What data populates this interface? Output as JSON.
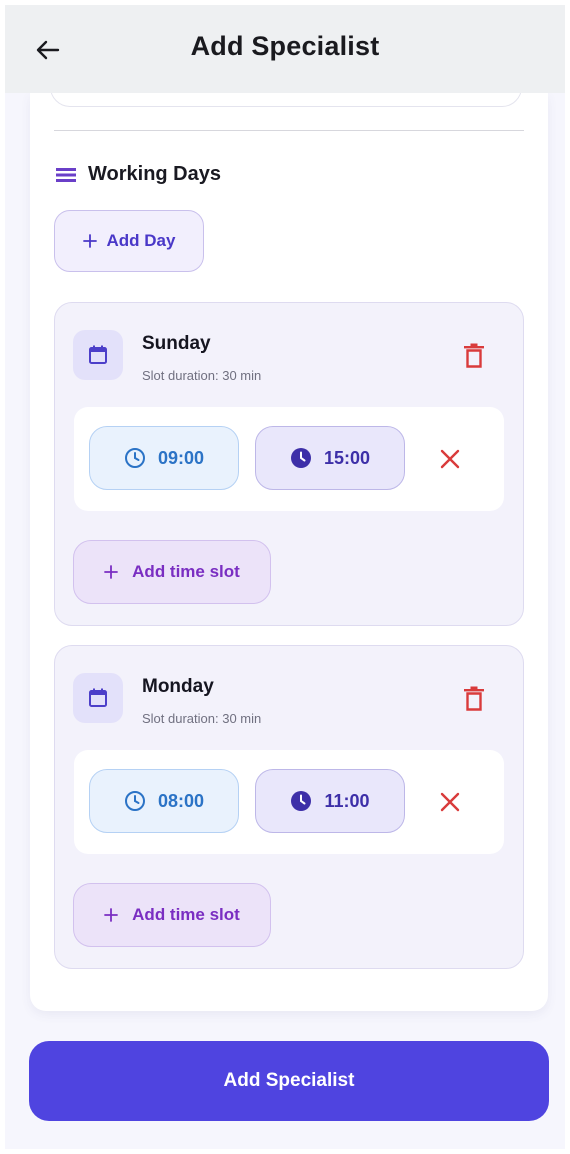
{
  "app_bar": {
    "title": "Add Specialist",
    "back_icon": "arrow-left-icon"
  },
  "working_days": {
    "section_title": "Working Days",
    "section_icon": "list-icon",
    "add_day_label": "Add Day",
    "days": [
      {
        "name": "Sunday",
        "slot_duration": "Slot duration: 30 min",
        "slots": [
          {
            "start": "09:00",
            "end": "15:00"
          }
        ],
        "add_slot_label": "Add time slot"
      },
      {
        "name": "Monday",
        "slot_duration": "Slot duration: 30 min",
        "slots": [
          {
            "start": "08:00",
            "end": "11:00"
          }
        ],
        "add_slot_label": "Add time slot"
      }
    ]
  },
  "submit": {
    "label": "Add Specialist"
  },
  "colors": {
    "primary": "#4f44e0",
    "accent_purple": "#7a2ec2",
    "start_time_blue": "#2b73c6",
    "end_time_indigo": "#3d2fa8",
    "delete_red": "#d93b3b",
    "background": "#f6f6fd"
  }
}
